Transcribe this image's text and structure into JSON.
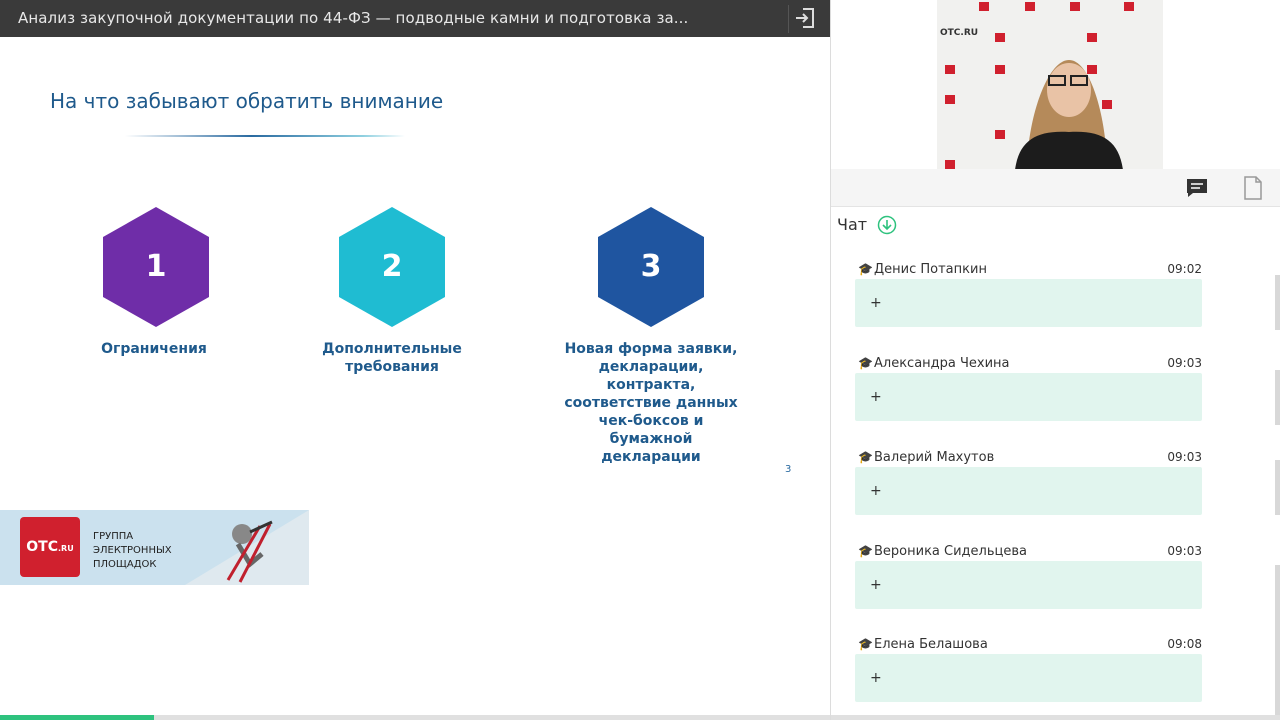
{
  "topbar": {
    "title": "Анализ закупочной документации по 44-ФЗ — подводные камни и подготовка за..."
  },
  "slide": {
    "title": "На что забывают обратить внимание",
    "items": [
      {
        "number": "1",
        "caption": "Ограничения",
        "color": "#6f2da8"
      },
      {
        "number": "2",
        "caption": "Дополнительные требования",
        "color": "#1fbcd2"
      },
      {
        "number": "3",
        "caption": "Новая форма заявки, декларации, контракта, соответствие данных чек-боксов и бумажной декларации",
        "color": "#1f55a0"
      }
    ],
    "page_number": "3"
  },
  "banner": {
    "logo": "ОТС",
    "logo_suffix": ".RU",
    "line1": "ГРУППА",
    "line2": "ЭЛЕКТРОННЫХ",
    "line3": "ПЛОЩАДОК"
  },
  "video": {
    "brand": "ОТС.RU"
  },
  "chat": {
    "title": "Чат",
    "messages": [
      {
        "author": "Денис Потапкин",
        "time": "09:02",
        "text": "+"
      },
      {
        "author": "Александра Чехина",
        "time": "09:03",
        "text": "+"
      },
      {
        "author": "Валерий Махутов",
        "time": "09:03",
        "text": "+"
      },
      {
        "author": "Вероника Сидельцева",
        "time": "09:03",
        "text": "+"
      },
      {
        "author": "Елена Белашова",
        "time": "09:08",
        "text": "+"
      }
    ]
  },
  "progress": {
    "fraction": 0.12,
    "color": "#2ec27e"
  }
}
